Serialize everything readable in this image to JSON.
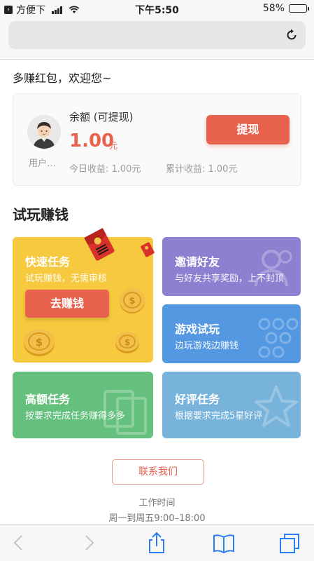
{
  "status_bar": {
    "carrier": "方便下",
    "time": "下午5:50",
    "battery": "58%",
    "battery_level": 0.58
  },
  "browser": {
    "url": ""
  },
  "welcome": "多赚红包，欢迎您~",
  "account": {
    "username": "用户…",
    "balance_label": "余额 (可提现)",
    "balance_amount": "1.00",
    "balance_unit": "元",
    "today_income": "今日收益: 1.00元",
    "total_income": "累计收益: 1.00元",
    "withdraw_label": "提现"
  },
  "section_title": "试玩赚钱",
  "tiles": {
    "quick": {
      "title": "快速任务",
      "desc": "试玩赚钱，无需审核",
      "button": "去赚钱"
    },
    "invite": {
      "title": "邀请好友",
      "desc": "与好友共享奖励，上不封顶"
    },
    "game": {
      "title": "游戏试玩",
      "desc": "边玩游戏边赚钱"
    },
    "high": {
      "title": "高额任务",
      "desc": "按要求完成任务赚得多多"
    },
    "review": {
      "title": "好评任务",
      "desc": "根据要求完成5星好评"
    }
  },
  "contact": {
    "button": "联系我们",
    "hours_label": "工作时间",
    "hours_value": "周一到周五9:00–18:00"
  },
  "colors": {
    "accent": "#e8624e",
    "quick_tile": "#f6c93e",
    "invite_tile": "#8f7fd0",
    "game_tile": "#5598e2",
    "high_tile": "#64c07c",
    "review_tile": "#78b3dc"
  },
  "toolbar": {
    "icons": [
      "back-icon",
      "forward-icon",
      "share-icon",
      "bookmarks-icon",
      "tabs-icon"
    ]
  }
}
